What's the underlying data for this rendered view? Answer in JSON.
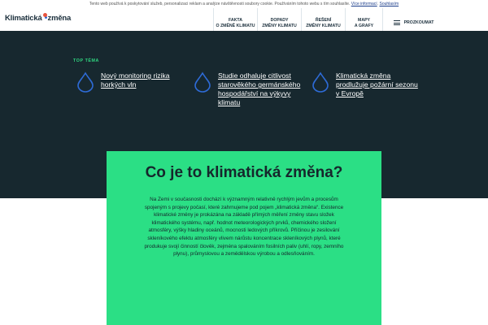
{
  "cookie": {
    "text": "Tento web používá k poskytování služeb, personalizaci reklam a analýze návštěvnosti soubory cookie. Používáním tohoto webu s tím souhlasíte.",
    "more_link": "Více informací",
    "agree": "Souhlasím"
  },
  "logo": {
    "part1": "Klimatická",
    "part2": "změna",
    "dot_colors": [
      "#e8533d",
      "#2e6bd6"
    ]
  },
  "nav": {
    "items": [
      {
        "line1": "FAKTA",
        "line2": "O ZMĚNĚ KLIMATU"
      },
      {
        "line1": "DOPADY",
        "line2": "ZMĚNY KLIMATU"
      },
      {
        "line1": "ŘEŠENÍ",
        "line2": "ZMĚNY KLIMATU"
      },
      {
        "line1": "MAPY",
        "line2": "A GRAFY"
      }
    ],
    "more_label": "PROZKOUMAT",
    "more_icon": "hamburger-icon"
  },
  "hero": {
    "label": "TOP TÉMA",
    "topic_icon": "water-drop-icon",
    "topics": [
      {
        "title": "Nový monitoring rizika horkých vln"
      },
      {
        "title": "Studie odhaluje citlivost starověkého germánského hospodářství na výkyvy klimatu"
      },
      {
        "title": "Klimatická změna prodlužuje požární sezonu v Evropě"
      }
    ],
    "bg_color": "#17282f",
    "accent": "#2fd680",
    "icon_color": "#2e6bd6"
  },
  "intro": {
    "heading": "Co je to klimatická změna?",
    "text": "Na Zemi v současnosti dochází k významným relativně rychlým jevům a procesům spojeným s projevy počasí, které zahrnujeme pod pojem „klimatická změna“. Existence klimatické změny je prokázána na základě přímých měření změny stavu složek klimatického systému, např. hodnot meteorologických prvků, chemického složení atmosféry, výšky hladiny oceánů, mocnosti ledových příkrovů. Příčinou je zesilování skleníkového efektu atmosféry vlivem nárůstu koncentrace skleníkových plynů, které produkuje svojí činností člověk, zejména spalováním fosilních paliv (uhlí, ropy, zemního plynu), průmyslovou a zemědělskou výrobou a odlesňováním.",
    "bg_color": "#2bdf85"
  }
}
